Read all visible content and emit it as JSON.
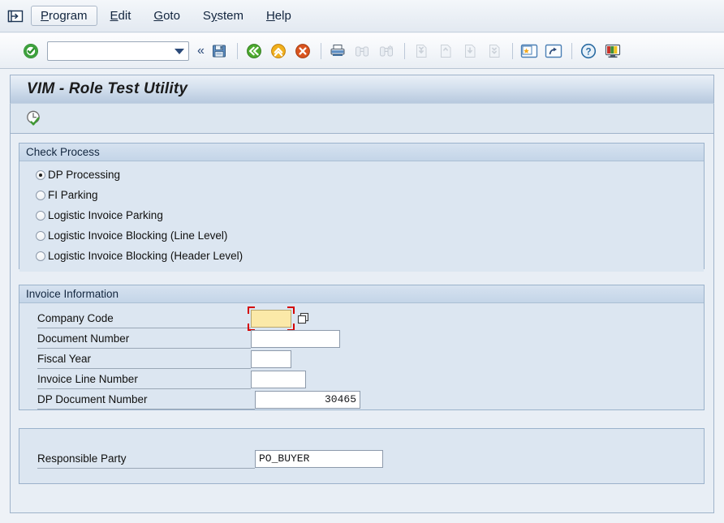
{
  "window": {
    "title": "VIM - Role Test Utility"
  },
  "menubar": {
    "system_icon": "system-menu-icon",
    "items": [
      {
        "id": "program",
        "label": "Program",
        "accel": "P",
        "active": true
      },
      {
        "id": "edit",
        "label": "Edit",
        "accel": "E",
        "active": false
      },
      {
        "id": "goto",
        "label": "Goto",
        "accel": "G",
        "active": false
      },
      {
        "id": "system",
        "label": "System",
        "accel": "y",
        "active": false
      },
      {
        "id": "help",
        "label": "Help",
        "accel": "H",
        "active": false
      }
    ]
  },
  "toolbar": {
    "enter_icon": "green-check-enter-icon",
    "command_field": {
      "value": "",
      "placeholder": ""
    },
    "collapse_icon": "double-chevron-left-icon",
    "buttons": [
      {
        "id": "save",
        "icon": "save-floppy-icon",
        "enabled": true
      },
      {
        "id": "back",
        "icon": "back-green-arrow-icon",
        "enabled": true
      },
      {
        "id": "exit",
        "icon": "exit-yellow-arrow-icon",
        "enabled": true
      },
      {
        "id": "cancel",
        "icon": "cancel-red-x-icon",
        "enabled": true
      },
      {
        "id": "print",
        "icon": "print-icon",
        "enabled": true
      },
      {
        "id": "find",
        "icon": "find-binoculars-icon",
        "enabled": false
      },
      {
        "id": "find-next",
        "icon": "find-next-binoculars-icon",
        "enabled": false
      },
      {
        "id": "first-page",
        "icon": "first-page-icon",
        "enabled": false
      },
      {
        "id": "previous-page",
        "icon": "previous-page-icon",
        "enabled": false
      },
      {
        "id": "next-page",
        "icon": "next-page-icon",
        "enabled": false
      },
      {
        "id": "last-page",
        "icon": "last-page-icon",
        "enabled": false
      },
      {
        "id": "create-session",
        "icon": "create-session-icon",
        "enabled": true
      },
      {
        "id": "create-shortcut",
        "icon": "create-shortcut-icon",
        "enabled": true
      },
      {
        "id": "help",
        "icon": "help-question-icon",
        "enabled": true
      },
      {
        "id": "customize",
        "icon": "customize-layout-icon",
        "enabled": true
      }
    ]
  },
  "app_toolbar": {
    "buttons": [
      {
        "id": "execute-check",
        "icon": "clock-check-execute-icon"
      }
    ]
  },
  "check_process": {
    "title": "Check Process",
    "options": [
      {
        "id": "dp-processing",
        "label": "DP Processing",
        "selected": true
      },
      {
        "id": "fi-parking",
        "label": "FI Parking",
        "selected": false
      },
      {
        "id": "logistic-invoice-parking",
        "label": "Logistic Invoice Parking",
        "selected": false
      },
      {
        "id": "logistic-invoice-blocking-line",
        "label": "Logistic Invoice Blocking (Line Level)",
        "selected": false
      },
      {
        "id": "logistic-invoice-blocking-header",
        "label": "Logistic Invoice Blocking (Header Level)",
        "selected": false
      }
    ]
  },
  "invoice_information": {
    "title": "Invoice Information",
    "fields": [
      {
        "id": "company-code",
        "label": "Company Code",
        "value": "",
        "required": true,
        "focused": true,
        "has_search_help": true
      },
      {
        "id": "document-number",
        "label": "Document Number",
        "value": "",
        "required": false,
        "focused": false,
        "has_search_help": false
      },
      {
        "id": "fiscal-year",
        "label": "Fiscal Year",
        "value": "",
        "required": false,
        "focused": false,
        "has_search_help": false
      },
      {
        "id": "invoice-line-number",
        "label": "Invoice Line Number",
        "value": "",
        "required": false,
        "focused": false,
        "has_search_help": false
      },
      {
        "id": "dp-document-number",
        "label": "DP Document Number",
        "value": "30465",
        "required": false,
        "focused": false,
        "has_search_help": false
      }
    ]
  },
  "responsible_party": {
    "label": "Responsible Party",
    "value": "PO_BUYER"
  },
  "colors": {
    "title_text": "#1b1b1b",
    "group_bg": "#dce6f1",
    "canvas_bg": "#e8eef5",
    "required_field": "#fbe9a8",
    "focus_marker": "#d40000",
    "accent_blue": "#2b4a79"
  }
}
